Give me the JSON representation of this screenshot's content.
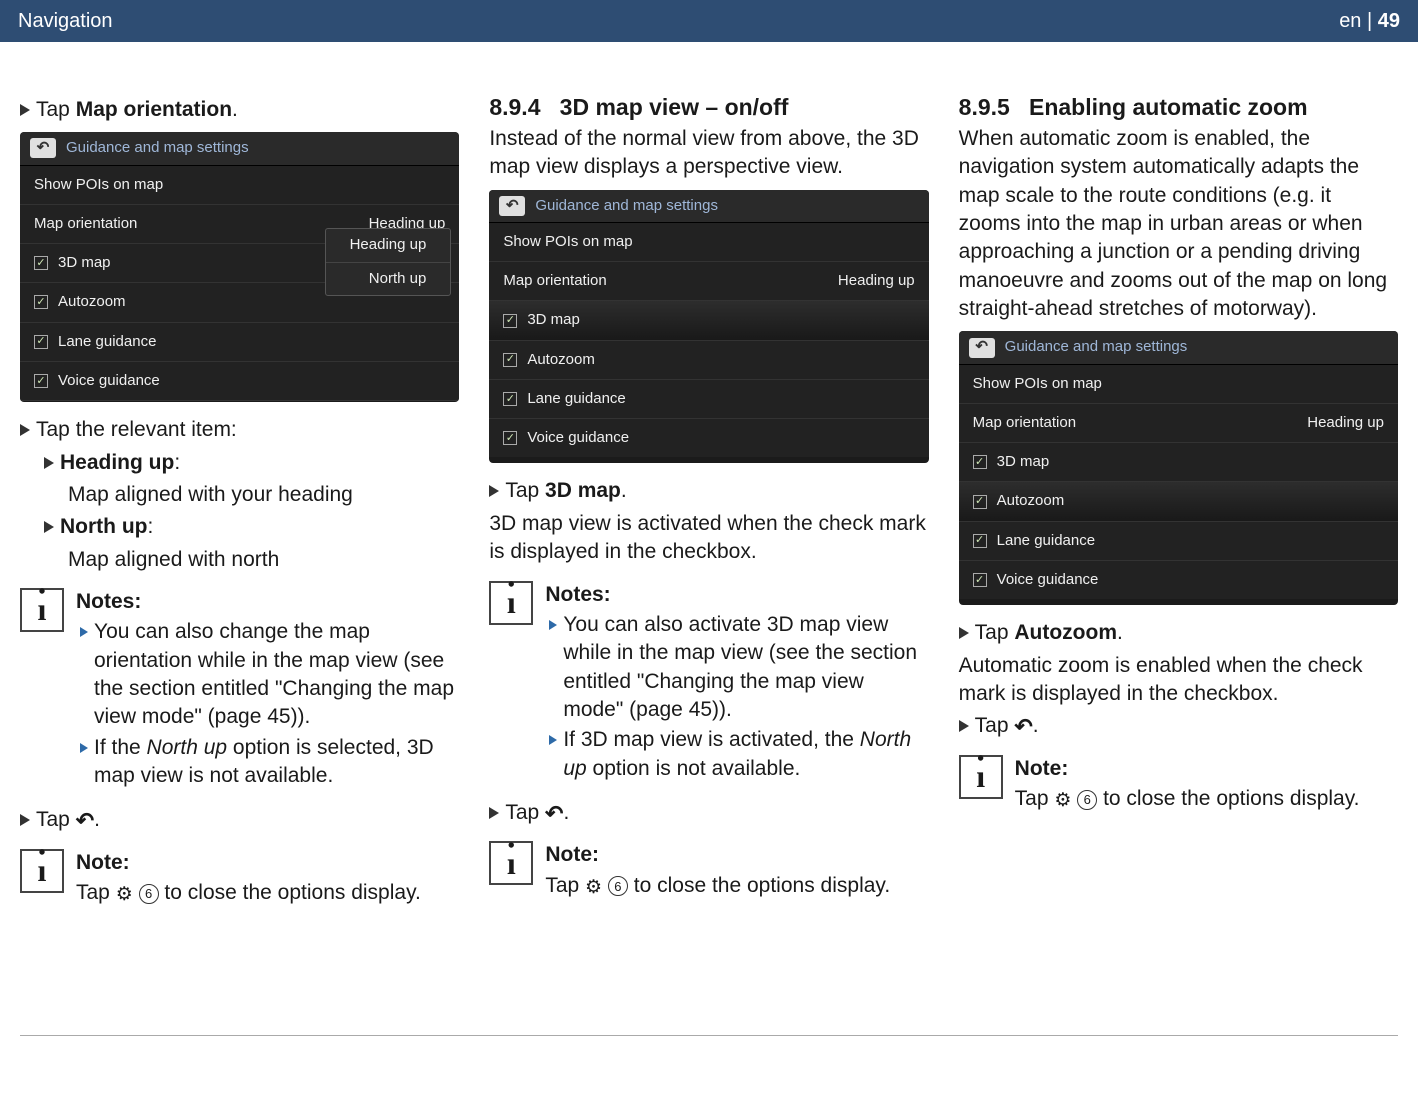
{
  "header": {
    "title": "Navigation",
    "lang_prefix": "en | ",
    "page": "49"
  },
  "ss": {
    "title": "Guidance and map settings",
    "rows": {
      "pois": "Show POIs on map",
      "orientation_label": "Map orientation",
      "orientation_value": "Heading up",
      "map3d": "3D map",
      "autozoom": "Autozoom",
      "lane": "Lane guidance",
      "voice": "Voice guidance"
    },
    "dropdown": {
      "opt1": "Heading up",
      "opt2": "North up"
    }
  },
  "col1": {
    "tap_map_orientation_pre": "Tap ",
    "tap_map_orientation_bold": "Map orientation",
    "tap_map_orientation_post": ".",
    "tap_relevant": "Tap the relevant item:",
    "heading_up_label": "Heading up",
    "heading_up_desc": "Map aligned with your heading",
    "north_up_label": "North up",
    "north_up_desc": "Map aligned with north",
    "notes_title": "Notes:",
    "note1": "You can also change the map orientation while in the map view (see the section entitled \"Changing the map view mode\" (page 45)).",
    "note2_pre": "If the ",
    "note2_it": "North up",
    "note2_post": " option is selected, 3D map view is not available.",
    "tap_back": "Tap ",
    "tap_back_post": ".",
    "note_single_title": "Note:",
    "note_single_pre": "Tap ",
    "note_single_post": " to close the options display.",
    "circled": "6"
  },
  "col2": {
    "heading_num": "8.9.4",
    "heading_title": "3D map view – on/off",
    "intro": "Instead of the normal view from above, the 3D map view displays a perspective view.",
    "tap_3d_pre": "Tap ",
    "tap_3d_bold": "3D map",
    "tap_3d_post": ".",
    "activated": "3D map view is activated when the check mark is displayed in the checkbox.",
    "notes_title": "Notes:",
    "note1": "You can also activate 3D map view while in the map view (see the section entitled \"Changing the map view mode\" (page 45)).",
    "note2_pre": "If 3D map view is activated, the ",
    "note2_it": "North up",
    "note2_post": " option is not available.",
    "tap_back": "Tap ",
    "tap_back_post": ".",
    "note_single_title": "Note:",
    "note_single_pre": "Tap ",
    "note_single_post": " to close the options display.",
    "circled": "6"
  },
  "col3": {
    "heading_num": "8.9.5",
    "heading_title": "Enabling automatic zoom",
    "intro": "When automatic zoom is enabled, the navigation system automatically adapts the map scale to the route conditions (e.g. it zooms into the map in urban areas or when approaching a junction or a pending driving manoeuvre and zooms out of the map on long straight-ahead stretches of motorway).",
    "tap_auto_pre": "Tap ",
    "tap_auto_bold": "Autozoom",
    "tap_auto_post": ".",
    "enabled": "Automatic zoom is enabled when the check mark is displayed in the checkbox.",
    "tap_back": "Tap ",
    "tap_back_post": ".",
    "note_single_title": "Note:",
    "note_single_pre": "Tap ",
    "note_single_post": " to close the options display.",
    "circled": "6"
  }
}
